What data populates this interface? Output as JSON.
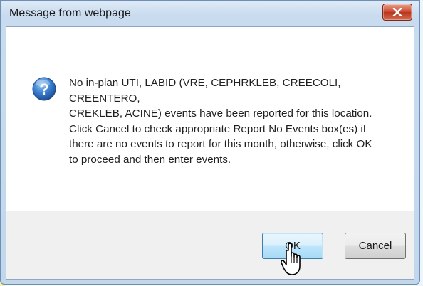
{
  "dialog": {
    "title": "Message from webpage",
    "close_icon": "close-icon",
    "message_icon": "question-icon",
    "message_lines": [
      "No in-plan UTI, LABID (VRE, CEPHRKLEB, CREECOLI, CREENTERO,",
      "CREKLEB, ACINE) events have been reported for this location.",
      "Click Cancel to check appropriate Report No Events box(es) if",
      "there are no events to report for this month, otherwise, click OK",
      "to proceed and then enter events."
    ],
    "buttons": {
      "ok_label": "OK",
      "cancel_label": "Cancel"
    },
    "colors": {
      "close_button": "#c9452a",
      "question_icon": "#2f6fc0",
      "ok_button_border": "#3c7fb1"
    }
  },
  "cursor": {
    "icon": "hand-pointer-icon"
  }
}
